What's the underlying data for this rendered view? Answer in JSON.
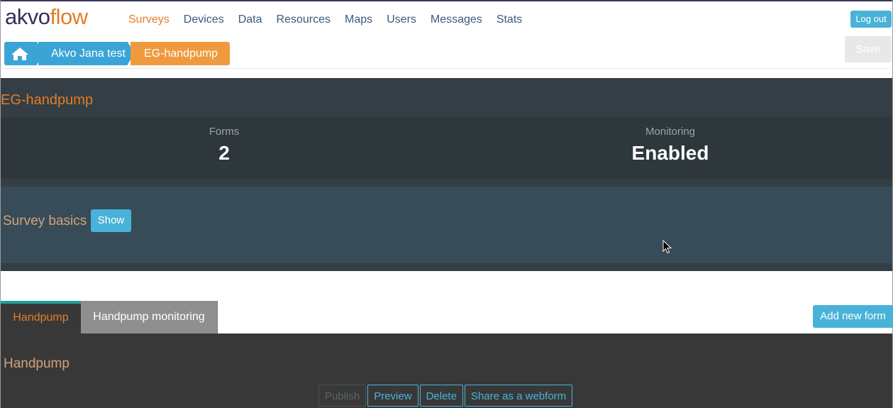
{
  "logo": {
    "part1": "akvo",
    "part2": "flow"
  },
  "nav": [
    "Surveys",
    "Devices",
    "Data",
    "Resources",
    "Maps",
    "Users",
    "Messages",
    "Stats"
  ],
  "header": {
    "logout_label": "Log out",
    "save_label": "Save"
  },
  "breadcrumb": {
    "home_icon": "home-icon",
    "folder": "Akvo Jana test",
    "current": "EG-handpump"
  },
  "survey": {
    "title": "EG-handpump",
    "forms_label": "Forms",
    "forms_value": "2",
    "monitoring_label": "Monitoring",
    "monitoring_value": "Enabled",
    "basics_label": "Survey basics",
    "show_label": "Show"
  },
  "tabs": [
    {
      "label": "Handpump",
      "active": true
    },
    {
      "label": "Handpump monitoring",
      "active": false
    }
  ],
  "add_form_label": "Add new form",
  "form": {
    "name": "Handpump",
    "actions": {
      "publish": "Publish",
      "preview": "Preview",
      "delete": "Delete",
      "share": "Share as a webform"
    }
  },
  "colors": {
    "accent_orange": "#e27d2a",
    "accent_blue": "#49b2d8",
    "teal": "#1e9e96"
  }
}
